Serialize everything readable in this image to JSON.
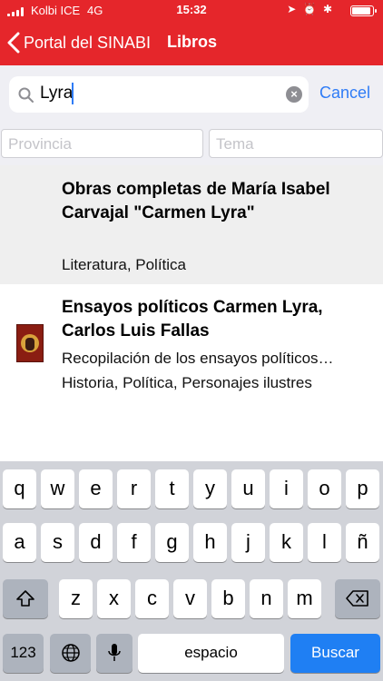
{
  "status": {
    "carrier": "Kolbi ICE",
    "network": "4G",
    "time": "15:32",
    "icons": "➤ ⏰ ✱"
  },
  "nav": {
    "back_label": "Portal del SINABI",
    "title": "Libros"
  },
  "search": {
    "value": "Lyra",
    "cancel_label": "Cancel"
  },
  "filters": {
    "province_placeholder": "Provincia",
    "topic_placeholder": "Tema"
  },
  "results": [
    {
      "title_line1": "Obras completas de María Isabel",
      "title_line2": "Carvajal \"Carmen Lyra\"",
      "description": "",
      "tags": "Literatura, Política"
    },
    {
      "title_line1": "Ensayos políticos Carmen Lyra,",
      "title_line2": "Carlos Luis Fallas",
      "description": "Recopilación de los ensayos políticos…",
      "tags": "Historia, Política, Personajes ilustres"
    }
  ],
  "keyboard": {
    "row1": [
      "q",
      "w",
      "e",
      "r",
      "t",
      "y",
      "u",
      "i",
      "o",
      "p"
    ],
    "row2": [
      "a",
      "s",
      "d",
      "f",
      "g",
      "h",
      "j",
      "k",
      "l",
      "ñ"
    ],
    "row3": [
      "z",
      "x",
      "c",
      "v",
      "b",
      "n",
      "m"
    ],
    "numbers_label": "123",
    "space_label": "espacio",
    "search_label": "Buscar"
  },
  "colors": {
    "nav_red": "#e5262b",
    "ios_blue": "#2f7cf6"
  }
}
